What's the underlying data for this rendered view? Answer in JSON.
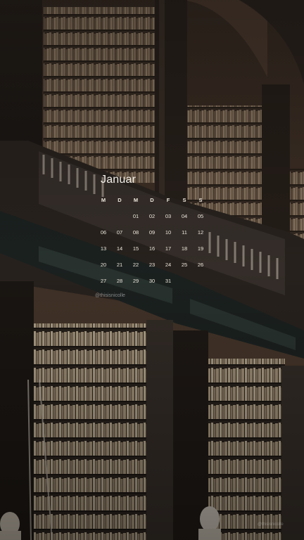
{
  "calendar": {
    "month": "Januar",
    "weekdays": [
      "M",
      "D",
      "M",
      "D",
      "F",
      "S",
      "S"
    ],
    "days": [
      [
        "",
        "",
        "01",
        "02",
        "03",
        "04",
        "05"
      ],
      [
        "06",
        "07",
        "08",
        "09",
        "10",
        "11",
        "12"
      ],
      [
        "13",
        "14",
        "15",
        "16",
        "17",
        "18",
        "19"
      ],
      [
        "20",
        "21",
        "22",
        "23",
        "24",
        "25",
        "26"
      ],
      [
        "27",
        "28",
        "29",
        "30",
        "31",
        "",
        ""
      ]
    ]
  },
  "credit": "@thisisnicolle",
  "credit_small": "@thisisnicolle",
  "colors": {
    "wood_dark": "#1f1a16",
    "wood_mid": "#4a3b30",
    "text": "#f3efe8"
  },
  "icons": {
    "background": "library-photo"
  }
}
